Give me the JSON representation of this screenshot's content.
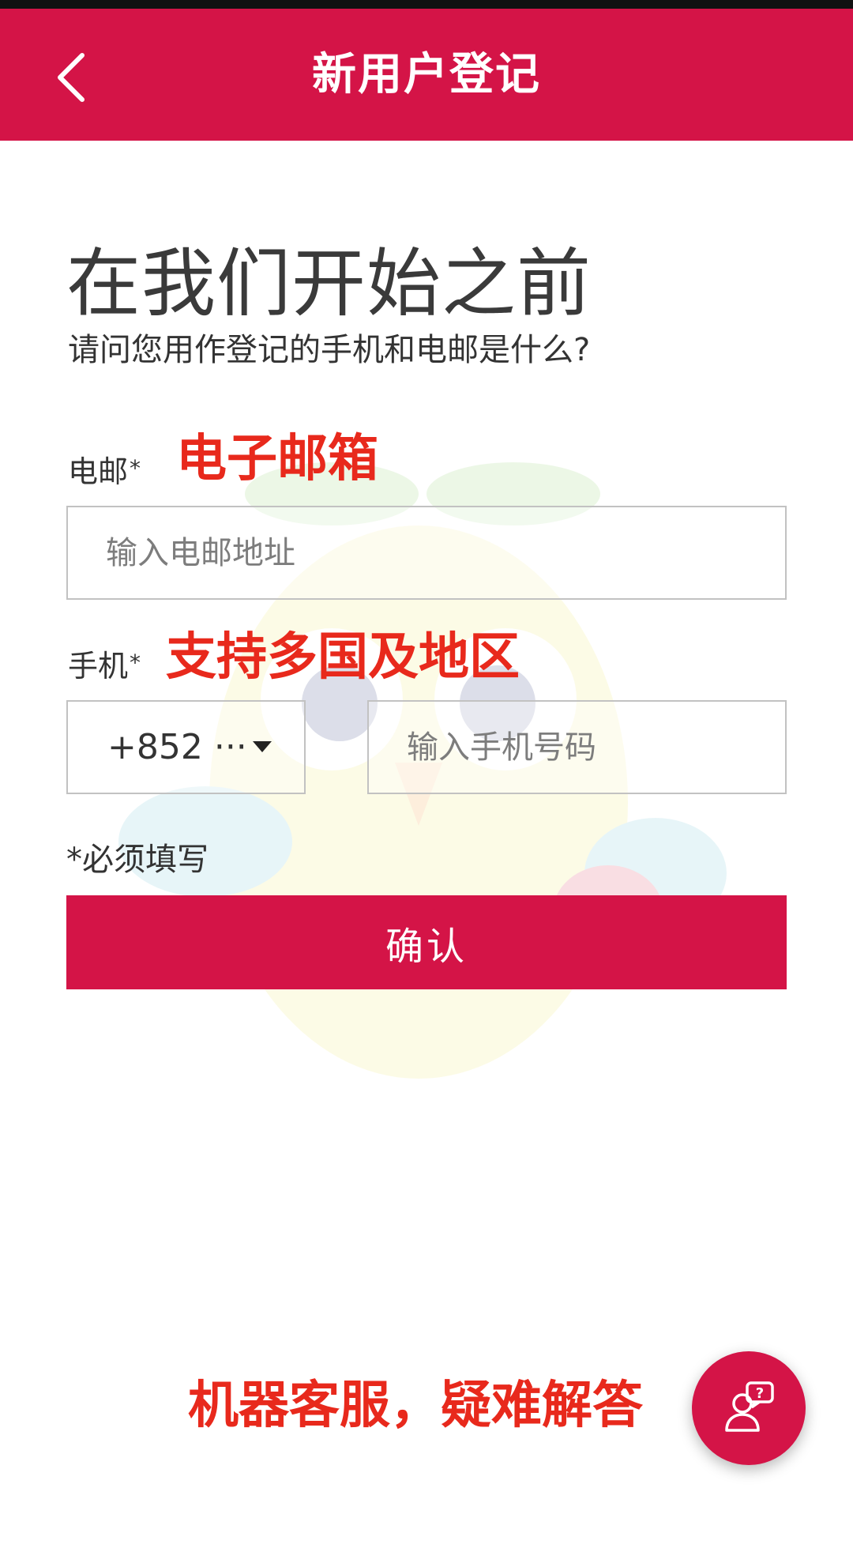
{
  "header": {
    "title": "新用户登记",
    "back_icon": "chevron-left-icon"
  },
  "intro": {
    "heading": "在我们开始之前",
    "subheading": "请问您用作登记的手机和电邮是什么?"
  },
  "email": {
    "label": "电邮",
    "required_mark": "*",
    "placeholder": "输入电邮地址",
    "value": "",
    "annotation": "电子邮箱"
  },
  "phone": {
    "label": "手机",
    "required_mark": "*",
    "country_code": "+852 ···",
    "placeholder": "输入手机号码",
    "value": "",
    "annotation": "支持多国及地区"
  },
  "form": {
    "required_note": "*必须填写",
    "confirm_label": "确认"
  },
  "support": {
    "annotation": "机器客服，疑难解答",
    "fab_icon": "help-chat-agent-icon"
  },
  "colors": {
    "brand": "#d41447",
    "annotation_red": "#e8291c",
    "input_border": "#c2c2c2"
  }
}
